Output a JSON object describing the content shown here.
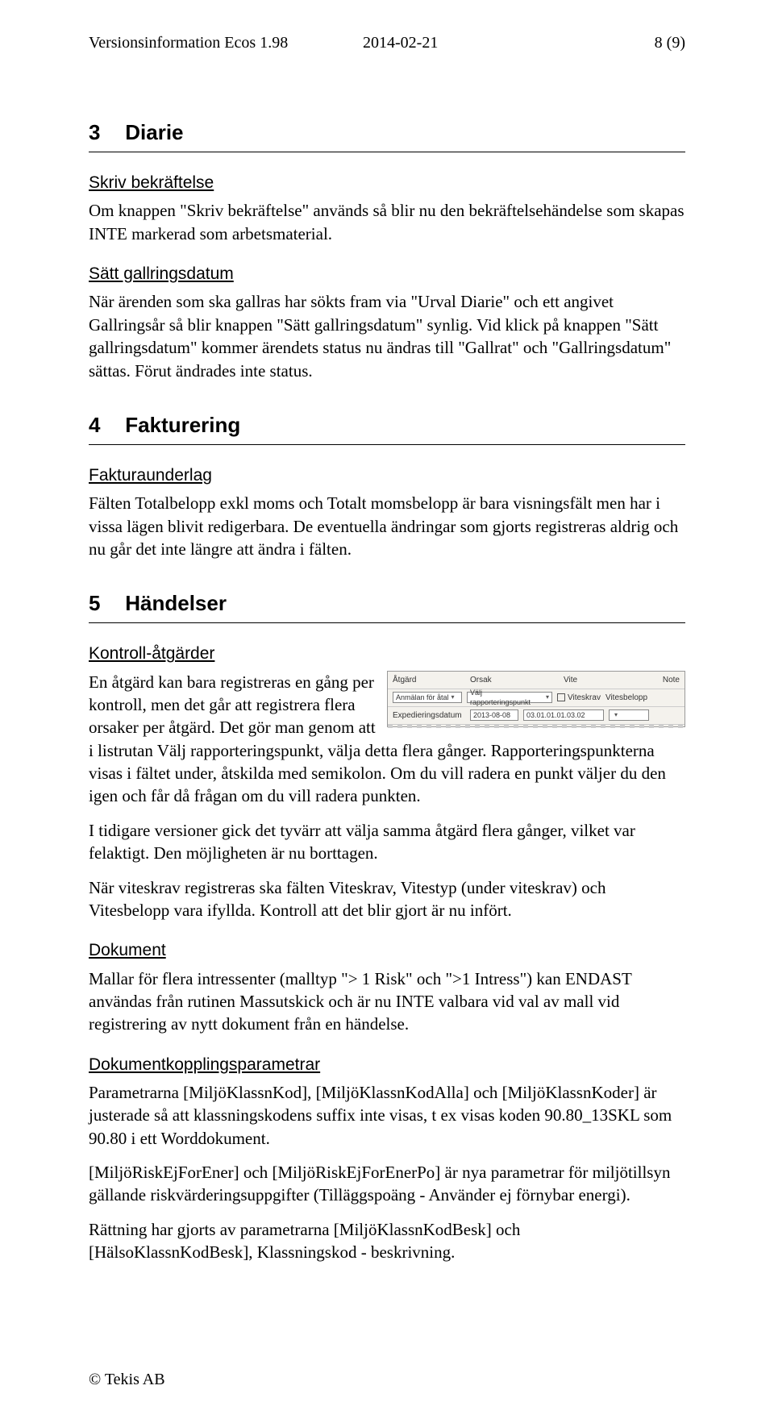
{
  "header": {
    "left": "Versionsinformation Ecos 1.98",
    "mid": "2014-02-21",
    "right": "8 (9)"
  },
  "s3": {
    "num": "3",
    "title": "Diarie",
    "sub1": "Skriv bekräftelse",
    "p1": "Om knappen \"Skriv bekräftelse\" används så blir nu den bekräftelsehändelse som skapas INTE markerad som arbetsmaterial.",
    "sub2": "Sätt gallringsdatum",
    "p2": "När ärenden som ska gallras har sökts fram via \"Urval Diarie\" och ett angivet Gallringsår så blir knappen \"Sätt gallringsdatum\" synlig. Vid klick på knappen \"Sätt gallringsdatum\" kommer ärendets status nu ändras till \"Gallrat\" och \"Gallringsdatum\" sättas. Förut ändrades inte status."
  },
  "s4": {
    "num": "4",
    "title": "Fakturering",
    "sub1": "Fakturaunderlag",
    "p1": "Fälten Totalbelopp exkl moms och Totalt momsbelopp är bara visningsfält men har i vissa lägen blivit redigerbara. De eventuella ändringar som gjorts registreras aldrig och nu går det inte längre att ändra i fälten."
  },
  "s5": {
    "num": "5",
    "title": "Händelser",
    "sub1": "Kontroll-åtgärder",
    "shot": {
      "h_atgard": "Åtgärd",
      "h_orsak": "Orsak",
      "h_vite": "Vite",
      "h_note": "Note",
      "r_anmalan": "Anmälan för åtal",
      "r_valj": "Välj rapporteringspunkt",
      "r_viteskrav": "Viteskrav",
      "r_vitesbelopp": "Vitesbelopp",
      "r_exp": "Expedieringsdatum",
      "r_date": "2013-08-08",
      "r_code": "03.01.01.01.03.02"
    },
    "p1": "En åtgärd kan bara registreras en gång per kontroll, men det går att registrera flera orsaker per åtgärd. Det gör man genom att i listrutan Välj rapporteringspunkt, välja detta flera gånger. Rapporteringspunkterna visas i fältet under, åtskilda med semikolon. Om du vill radera en punkt väljer du den igen och får då frågan om du vill radera punkten.",
    "p2": "I tidigare versioner gick det tyvärr att välja samma åtgärd flera gånger, vilket var felaktigt. Den möjligheten är nu borttagen.",
    "p3": "När viteskrav registreras ska fälten Viteskrav, Vitestyp (under viteskrav) och Vitesbelopp vara ifyllda. Kontroll att det blir gjort är nu infört.",
    "sub2": "Dokument",
    "p4": "Mallar för flera intressenter (malltyp \"> 1 Risk\" och \">1 Intress\") kan ENDAST användas från rutinen Massutskick och är nu INTE valbara vid val av mall vid registrering av nytt dokument från en händelse.",
    "sub3": "Dokumentkopplingsparametrar",
    "p5": "Parametrarna [MiljöKlassnKod], [MiljöKlassnKodAlla] och [MiljöKlassnKoder] är justerade så att klassningskodens suffix inte visas, t ex visas koden 90.80_13SKL som 90.80 i ett Worddokument.",
    "p6": "[MiljöRiskEjForEner] och [MiljöRiskEjForEnerPo] är nya parametrar för miljötillsyn gällande riskvärderingsuppgifter (Tilläggspoäng - Använder ej förnybar energi).",
    "p7": "Rättning har gjorts av parametrarna [MiljöKlassnKodBesk] och [HälsoKlassnKodBesk], Klassningskod - beskrivning."
  },
  "footer": "© Tekis AB"
}
